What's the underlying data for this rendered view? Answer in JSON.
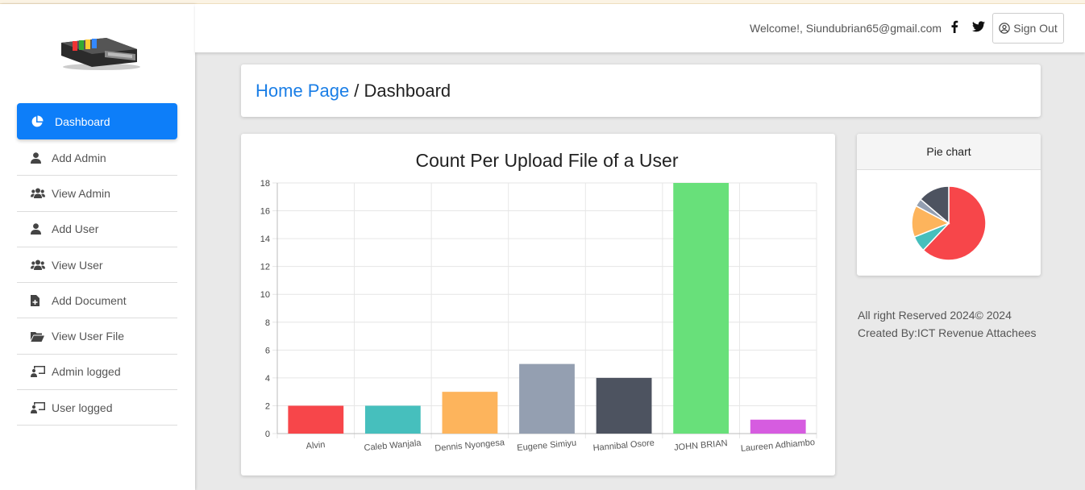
{
  "header": {
    "welcome_text": "Welcome!, Siundubrian65@gmail.com",
    "signout_label": "Sign Out"
  },
  "sidebar": {
    "items": [
      {
        "label": "Dashboard",
        "icon": "pie-chart-icon",
        "active": true
      },
      {
        "label": "Add Admin",
        "icon": "user-icon"
      },
      {
        "label": "View Admin",
        "icon": "users-icon"
      },
      {
        "label": "Add User",
        "icon": "user-icon"
      },
      {
        "label": "View User",
        "icon": "users-icon"
      },
      {
        "label": "Add Document",
        "icon": "file-plus-icon"
      },
      {
        "label": "View User File",
        "icon": "folder-open-icon"
      },
      {
        "label": "Admin logged",
        "icon": "chalkboard-user-icon"
      },
      {
        "label": "User logged",
        "icon": "chalkboard-user-icon"
      }
    ]
  },
  "breadcrumb": {
    "home": "Home Page",
    "separator": " / ",
    "current": "Dashboard"
  },
  "pie_card": {
    "title": "Pie chart"
  },
  "footer": {
    "line1": "All right Reserved 2024© 2024",
    "line2": "Created By:ICT Revenue Attachees"
  },
  "colors": {
    "accent": "#0d7ef9",
    "link": "#1a7ee6"
  },
  "chart_data": [
    {
      "type": "bar",
      "title": "Count Per Upload File of a User",
      "categories": [
        "Alvin",
        "Caleb Wanjala",
        "Dennis Nyongesa",
        "Eugene Simiyu",
        "Hannibal Osore",
        "JOHN BRIAN",
        "Laureen Adhiambo"
      ],
      "values": [
        2,
        2,
        3,
        5,
        4,
        18,
        1
      ],
      "colors": [
        "#f7464a",
        "#46bfbd",
        "#fdb45c",
        "#949fb1",
        "#4d5360",
        "#68e07a",
        "#d65ce0"
      ],
      "ylim": [
        0,
        18
      ],
      "yticks": [
        0,
        2,
        4,
        6,
        8,
        10,
        12,
        14,
        16,
        18
      ],
      "grid": true
    },
    {
      "type": "pie",
      "title": "",
      "values": [
        18,
        2,
        4,
        1,
        4
      ],
      "colors": [
        "#f7464a",
        "#46bfbd",
        "#fdb45c",
        "#949fb1",
        "#4d5360"
      ]
    }
  ]
}
